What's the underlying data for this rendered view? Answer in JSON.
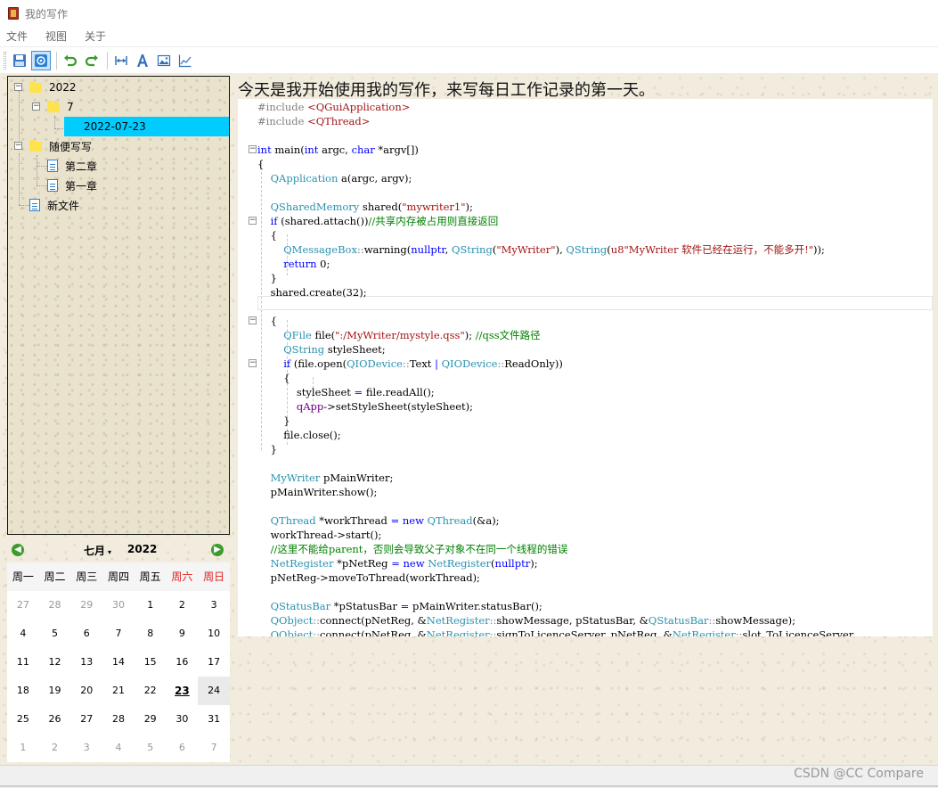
{
  "window": {
    "title": "我的写作"
  },
  "menu": [
    "文件",
    "视图",
    "关于"
  ],
  "toolbar": {
    "buttons": [
      "save-icon",
      "view-icon",
      "undo-icon",
      "redo-icon",
      "width-icon",
      "font-icon",
      "image-icon",
      "chart-icon"
    ]
  },
  "tree": {
    "year": "2022",
    "month": "7",
    "date": "2022-07-23",
    "folder2": "随便写写",
    "chapter2": "第二章",
    "chapter1": "第一章",
    "newfile": "新文件"
  },
  "calendar": {
    "month": "七月",
    "year": "2022",
    "weekdays": [
      "周一",
      "周二",
      "周三",
      "周四",
      "周五",
      "周六",
      "周日"
    ],
    "weeks": [
      [
        "27",
        "28",
        "29",
        "30",
        "1",
        "2",
        "3"
      ],
      [
        "4",
        "5",
        "6",
        "7",
        "8",
        "9",
        "10"
      ],
      [
        "11",
        "12",
        "13",
        "14",
        "15",
        "16",
        "17"
      ],
      [
        "18",
        "19",
        "20",
        "21",
        "22",
        "23",
        "24"
      ],
      [
        "25",
        "26",
        "27",
        "28",
        "29",
        "30",
        "31"
      ],
      [
        "1",
        "2",
        "3",
        "4",
        "5",
        "6",
        "7"
      ]
    ],
    "today": "23",
    "selected": "24"
  },
  "editor": {
    "heading": "今天是我开始使用我的写作，来写每日工作记录的第一天。"
  },
  "watermark": "CSDN @CC Compare",
  "colors": {
    "selection": "#00ccff",
    "keyword": "#0000ff",
    "string": "#a31515",
    "class": "#2b91af",
    "comment": "#008000"
  }
}
